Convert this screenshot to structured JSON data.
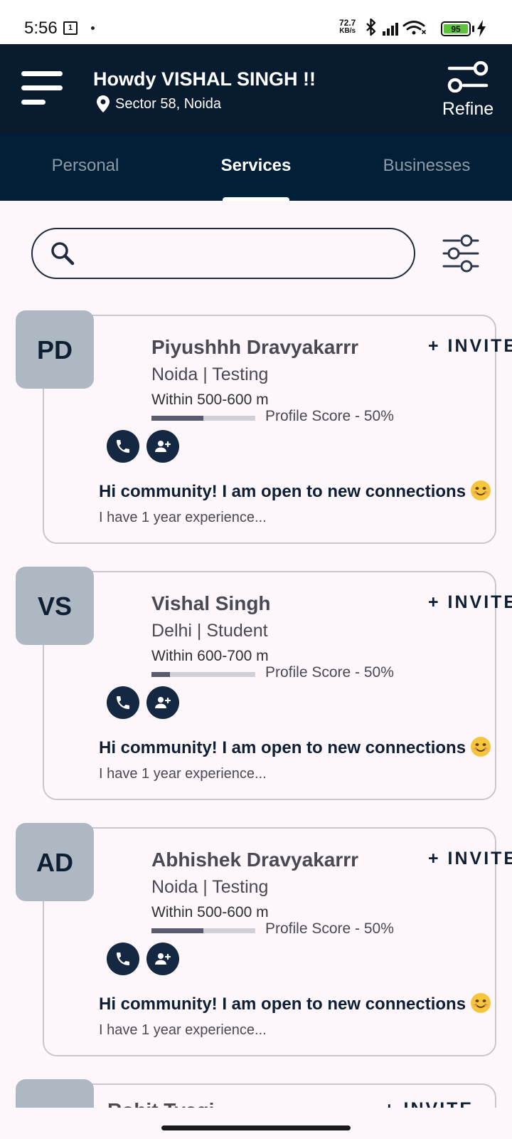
{
  "status_bar": {
    "time": "5:56",
    "notif_glyph": "1",
    "net_speed_value": "72.7",
    "net_speed_unit": "KB/s",
    "battery": "95",
    "battery_color": "#5ec23b"
  },
  "header": {
    "greeting": "Howdy VISHAL SINGH !!",
    "location": "Sector 58, Noida",
    "refine_label": "Refine",
    "bg_color": "#091c2f"
  },
  "tabs": [
    {
      "label": "Personal",
      "active": false
    },
    {
      "label": "Services",
      "active": true
    },
    {
      "label": "Businesses",
      "active": false
    }
  ],
  "search": {
    "value": "",
    "placeholder": ""
  },
  "cards": [
    {
      "initials": "PD",
      "name": "Piyushhh Dravyakarrr",
      "invite_label": "+ INVITE",
      "subtitle": "Noida | Testing",
      "distance": "Within 500-600 m",
      "score_label": "Profile Score - 50%",
      "score_fill": 0.5,
      "message": "Hi community! I am open to new connections",
      "detail": "I have 1 year experience..."
    },
    {
      "initials": "VS",
      "name": "Vishal Singh",
      "invite_label": "+ INVITE",
      "subtitle": "Delhi | Student",
      "distance": "Within 600-700 m",
      "score_label": "Profile Score - 50%",
      "score_fill": 0.18,
      "message": "Hi community! I am open to new connections",
      "detail": "I have 1 year experience..."
    },
    {
      "initials": "AD",
      "name": "Abhishek Dravyakarrr",
      "invite_label": "+ INVITE",
      "subtitle": "Noida | Testing",
      "distance": "Within 500-600 m",
      "score_label": "Profile Score - 50%",
      "score_fill": 0.5,
      "message": "Hi community! I am open to new connections",
      "detail": "I have 1 year experience..."
    }
  ],
  "partial_card": {
    "name": "Rohit Tyagi",
    "invite_label": "+ INVITE"
  }
}
